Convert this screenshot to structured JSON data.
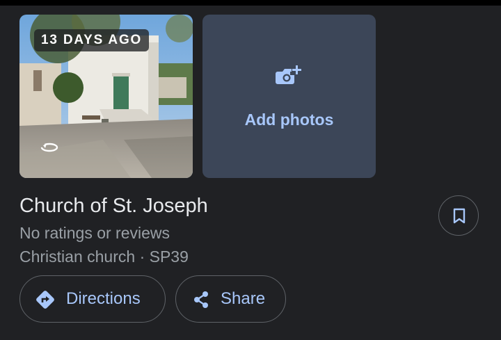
{
  "photo": {
    "age_badge": "13 DAYS AGO",
    "icon": "panorama-360-icon"
  },
  "add_photos": {
    "label": "Add photos",
    "icon": "add-photo-camera-icon"
  },
  "place": {
    "title": "Church of St. Joseph",
    "ratings": "No ratings or reviews",
    "category_line": "Christian church · SP39"
  },
  "save": {
    "icon": "bookmark-icon"
  },
  "actions": {
    "directions_label": "Directions",
    "directions_icon": "directions-icon",
    "share_label": "Share",
    "share_icon": "share-icon"
  },
  "colors": {
    "background": "#202124",
    "accent": "#a8c7fa",
    "tile": "#3c4658",
    "secondary_text": "#9aa0a6"
  }
}
